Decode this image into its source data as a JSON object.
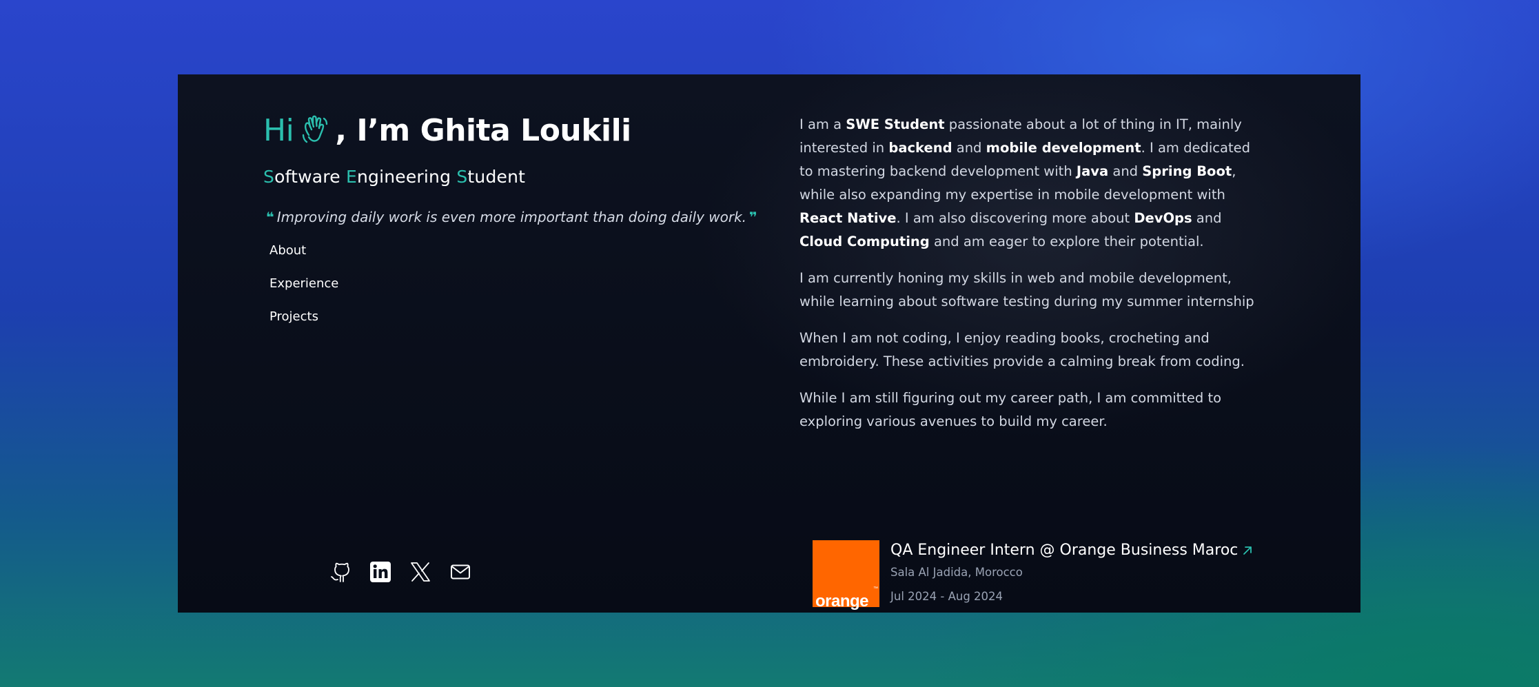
{
  "header": {
    "hi": "Hi",
    "name_rest": ", I’m Ghita Loukili",
    "role": [
      {
        "initial": "S",
        "rest": "oftware "
      },
      {
        "initial": "E",
        "rest": "ngineering "
      },
      {
        "initial": "S",
        "rest": "tudent"
      }
    ],
    "quote_open": "❝",
    "quote": "Improving daily work is even more important than doing daily work.",
    "quote_close": "❞"
  },
  "nav": {
    "items": [
      "About",
      "Experience",
      "Projects"
    ]
  },
  "socials": {
    "icons": [
      "github-icon",
      "linkedin-icon",
      "x-twitter-icon",
      "mail-icon"
    ]
  },
  "about": {
    "p1": [
      {
        "t": "I am a "
      },
      {
        "t": "SWE Student",
        "b": true
      },
      {
        "t": " passionate about a lot of thing in IT, mainly interested in "
      },
      {
        "t": "backend",
        "b": true
      },
      {
        "t": " and "
      },
      {
        "t": "mobile development",
        "b": true
      },
      {
        "t": ". I am dedicated to mastering backend development with "
      },
      {
        "t": "Java",
        "b": true
      },
      {
        "t": " and "
      },
      {
        "t": "Spring Boot",
        "b": true
      },
      {
        "t": ", while also expanding my expertise in mobile development with "
      },
      {
        "t": "React Native",
        "b": true
      },
      {
        "t": ". I am also discovering more about "
      },
      {
        "t": "DevOps",
        "b": true
      },
      {
        "t": " and "
      },
      {
        "t": "Cloud Computing",
        "b": true
      },
      {
        "t": " and am eager to explore their potential."
      }
    ],
    "p2": "I am currently honing my skills in web and mobile development, while learning about software testing during my summer internship",
    "p3": "When I am not coding, I enjoy reading books, crocheting and embroidery. These activities provide a calming break from coding.",
    "p4": "While I am still figuring out my career path, I am committed to exploring various avenues to build my career."
  },
  "experience": {
    "logo_text": "orange",
    "logo_tm": "™",
    "title": "QA Engineer Intern @ Orange Business Maroc",
    "location": "Sala Al Jadida, Morocco",
    "dates": "Jul 2024 - Aug 2024"
  },
  "colors": {
    "accent": "#2bbfae",
    "card_bg": "#0a0f1b",
    "orange_brand": "#ff6600"
  }
}
